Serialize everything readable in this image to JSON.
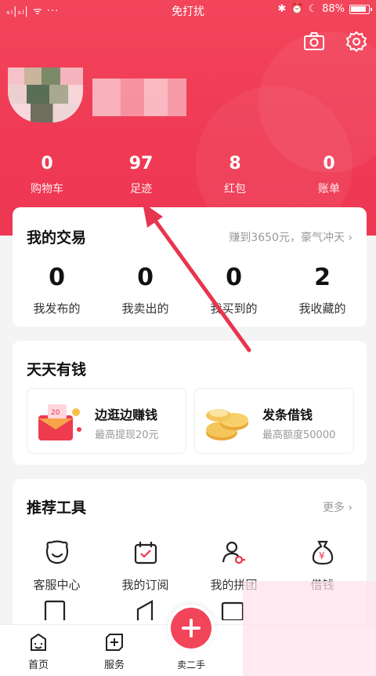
{
  "status_bar": {
    "signal": "ₛₗ|ₛₗ| ᯤ ···",
    "dnd": "免打扰",
    "battery_pct": "88%"
  },
  "stats": [
    {
      "num": "0",
      "label": "购物车"
    },
    {
      "num": "97",
      "label": "足迹"
    },
    {
      "num": "8",
      "label": "红包"
    },
    {
      "num": "0",
      "label": "账单"
    }
  ],
  "trade": {
    "title": "我的交易",
    "more": "赚到3650元，豪气冲天 ›",
    "items": [
      {
        "num": "0",
        "label": "我发布的"
      },
      {
        "num": "0",
        "label": "我卖出的"
      },
      {
        "num": "0",
        "label": "我买到的"
      },
      {
        "num": "2",
        "label": "我收藏的"
      }
    ]
  },
  "money": {
    "title": "天天有钱",
    "items": [
      {
        "title": "边逛边赚钱",
        "sub": "最高提现20元"
      },
      {
        "title": "发条借钱",
        "sub": "最高额度50000"
      }
    ]
  },
  "tools": {
    "title": "推荐工具",
    "more": "更多 ›",
    "items": [
      {
        "label": "客服中心",
        "icon": "customer-service-icon"
      },
      {
        "label": "我的订阅",
        "icon": "subscription-icon"
      },
      {
        "label": "我的拼团",
        "icon": "group-buy-icon"
      },
      {
        "label": "借钱",
        "icon": "money-bag-icon"
      }
    ]
  },
  "tabbar": {
    "home": "首页",
    "service": "服务",
    "sell": "卖二手"
  },
  "colors": {
    "brand": "#f2455a",
    "arrow": "#e8354f"
  }
}
